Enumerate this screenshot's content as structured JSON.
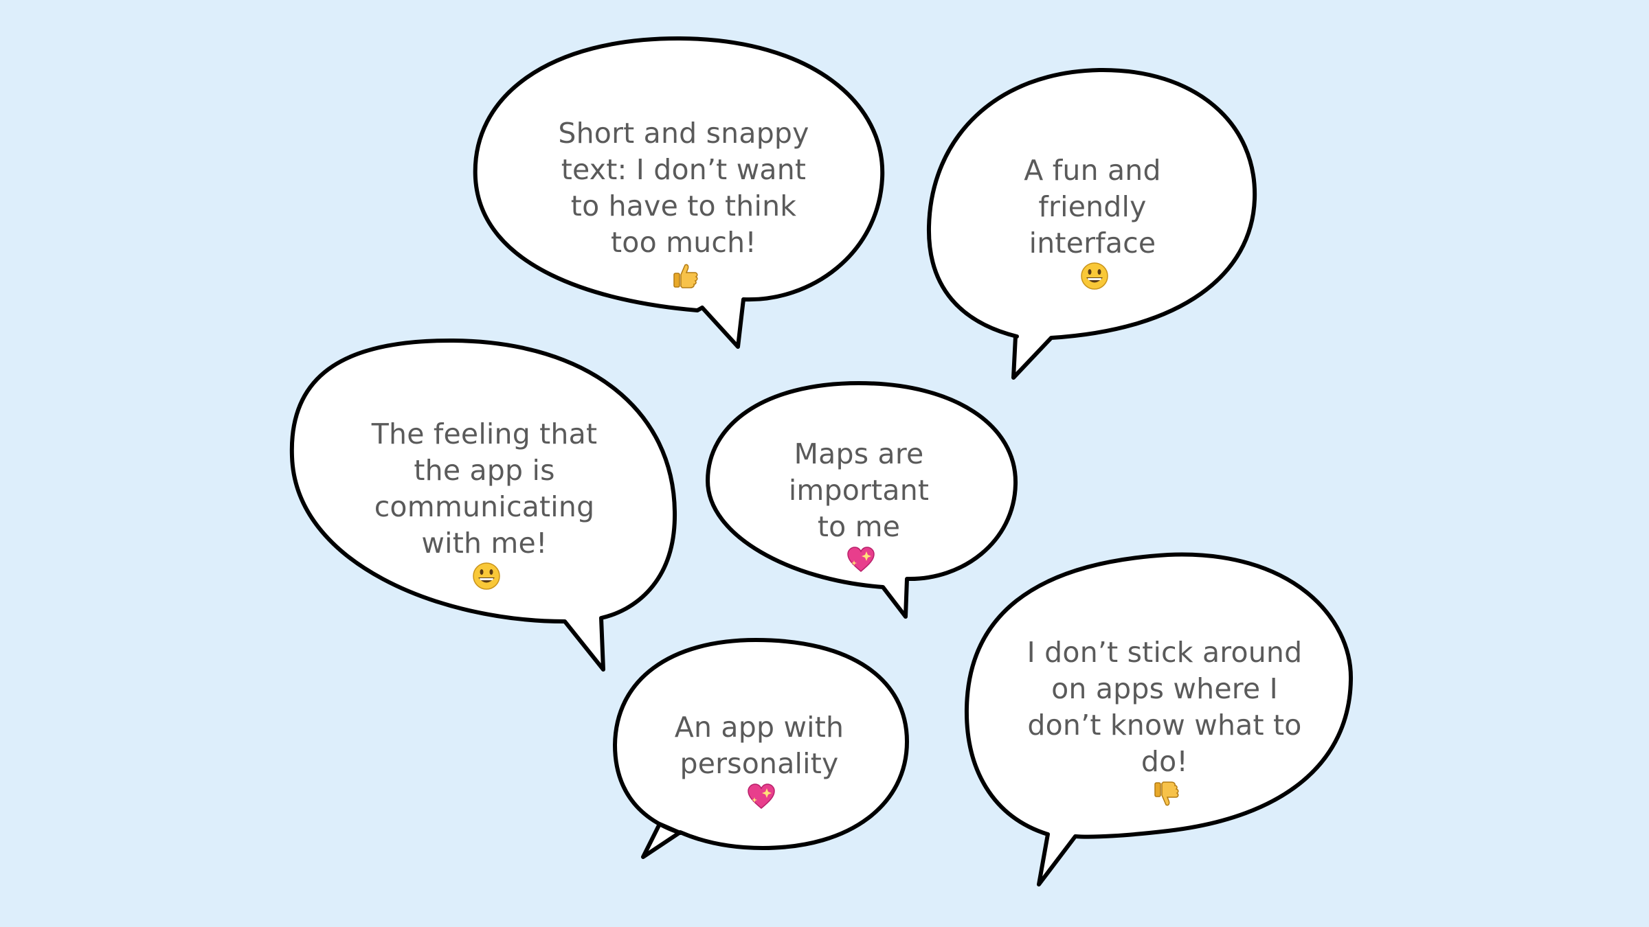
{
  "background_color": "#ddeefb",
  "bubble_fill": "#ffffff",
  "bubble_stroke": "#000000",
  "text_color": "#5a5a5a",
  "bubbles": [
    {
      "lines": [
        "Short and snappy",
        "text: I don’t want",
        "to have to think",
        "too much!"
      ],
      "icon": "thumbs-up-icon"
    },
    {
      "lines": [
        "A fun and",
        "friendly",
        "interface"
      ],
      "icon": "grinning-face-icon"
    },
    {
      "lines": [
        "The feeling that",
        "the app is",
        "communicating",
        "with me!"
      ],
      "icon": "grinning-face-icon"
    },
    {
      "lines": [
        "Maps are",
        "important",
        "to me"
      ],
      "icon": "sparkling-heart-icon"
    },
    {
      "lines": [
        "An app with",
        "personality"
      ],
      "icon": "sparkling-heart-icon"
    },
    {
      "lines": [
        "I don’t stick around",
        "on apps where I",
        "don’t know what to",
        "do!"
      ],
      "icon": "thumbs-down-icon"
    }
  ]
}
